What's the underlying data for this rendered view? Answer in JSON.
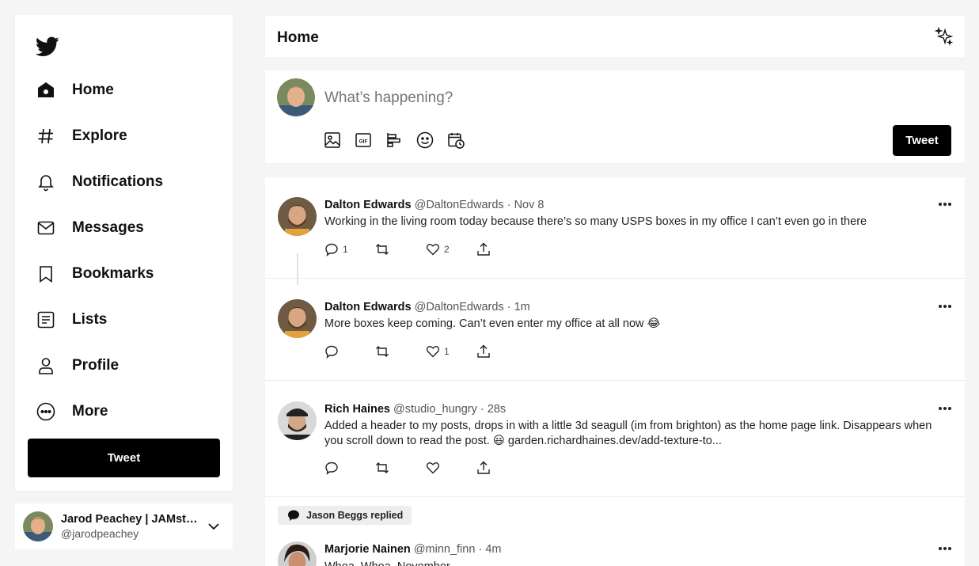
{
  "sidebar": {
    "items": [
      {
        "label": "Home",
        "icon": "home-icon"
      },
      {
        "label": "Explore",
        "icon": "hashtag-icon"
      },
      {
        "label": "Notifications",
        "icon": "bell-icon"
      },
      {
        "label": "Messages",
        "icon": "mail-icon"
      },
      {
        "label": "Bookmarks",
        "icon": "bookmark-icon"
      },
      {
        "label": "Lists",
        "icon": "list-icon"
      },
      {
        "label": "Profile",
        "icon": "user-icon"
      },
      {
        "label": "More",
        "icon": "more-circle-icon"
      }
    ],
    "tweet_label": "Tweet"
  },
  "account": {
    "name": "Jarod Peachey | JAMstack Developer",
    "handle": "@jarodpeachey"
  },
  "header": {
    "title": "Home"
  },
  "composer": {
    "placeholder": "What’s happening?",
    "tweet_label": "Tweet",
    "tools": [
      "image-icon",
      "gif-icon",
      "poll-icon",
      "emoji-icon",
      "schedule-icon"
    ]
  },
  "posts": [
    {
      "name": "Dalton Edwards",
      "handle": "@DaltonEdwards",
      "dot": "·",
      "time": "Nov 8",
      "text": "Working in the living room today because there’s so many USPS boxes in my office I can’t even go in there",
      "replies": "1",
      "retweets": "",
      "likes": "2"
    },
    {
      "name": "Dalton Edwards",
      "handle": "@DaltonEdwards",
      "dot": "·",
      "time": "1m",
      "text": "More boxes keep coming. Can’t even enter my office at all now 😂",
      "replies": "",
      "retweets": "",
      "likes": "1"
    },
    {
      "name": "Rich Haines",
      "handle": "@studio_hungry",
      "dot": "·",
      "time": "28s",
      "text": "Added a header to my posts, drops in with a little 3d seagull (im from brighton) as the home page link. Disappears when you scroll down to read the post. 😃 garden.richardhaines.dev/add-texture-to...",
      "replies": "",
      "retweets": "",
      "likes": ""
    },
    {
      "reply_context": "Jason Beggs replied",
      "name": "Marjorie Nainen",
      "handle": "@minn_finn",
      "dot": "·",
      "time": "4m",
      "text": "Whoa. Whoa. November."
    }
  ],
  "colors": {
    "accent": "#000000",
    "background": "#f5f5f5",
    "muted": "#555555"
  }
}
